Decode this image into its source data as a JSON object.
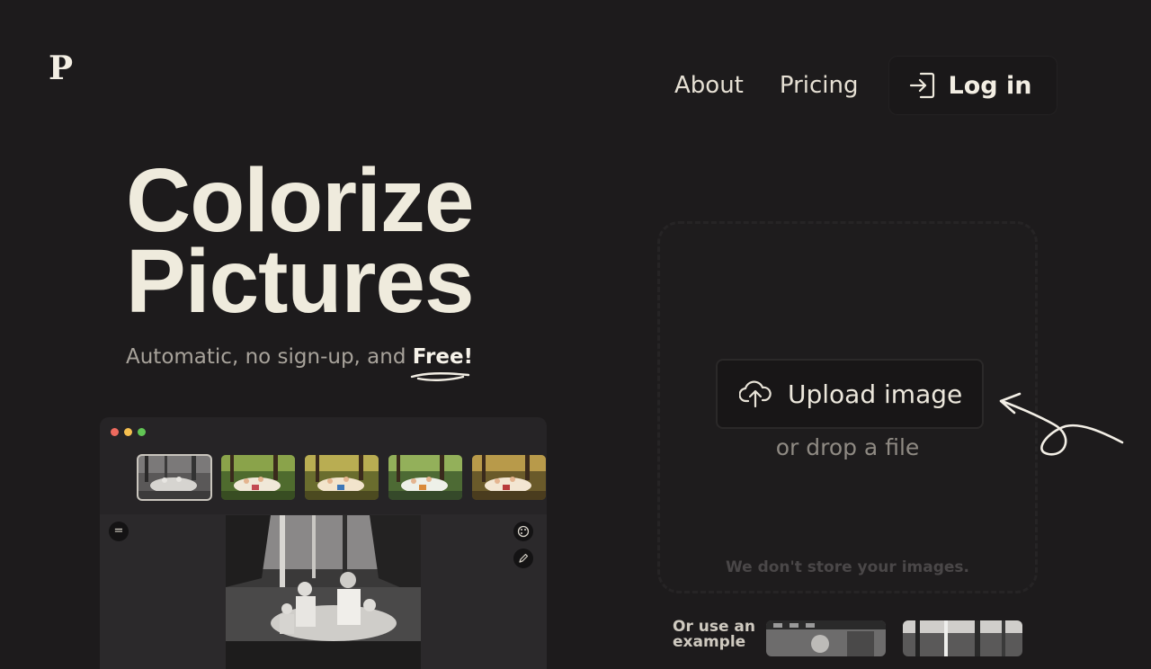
{
  "brand": {
    "logo_letter": "P"
  },
  "nav": {
    "links": [
      {
        "label": "About"
      },
      {
        "label": "Pricing"
      }
    ],
    "login_label": "Log in"
  },
  "hero": {
    "title_lines": [
      "Colorize",
      "Pictures"
    ],
    "subtitle_lead": "Automatic, no sign-up, and ",
    "subtitle_emphasis": "Free!"
  },
  "upload": {
    "button_label": "Upload image",
    "drop_text": "or drop a file",
    "privacy_note": "We don't store your images."
  },
  "examples": {
    "label": "Or use an example"
  },
  "preview": {
    "dot_colors": [
      "#ed6a5e",
      "#f5bf4f",
      "#61c554"
    ],
    "thumbnails": [
      {
        "kind": "grayscale"
      },
      {
        "kind": "colorized"
      },
      {
        "kind": "colorized"
      },
      {
        "kind": "colorized"
      },
      {
        "kind": "colorized"
      }
    ],
    "selected_thumbnail_index": 0
  },
  "colors": {
    "background": "#1d1b1c",
    "heading": "#efebdd",
    "muted_text": "#a8a39b",
    "dropzone_border": "#262425"
  }
}
